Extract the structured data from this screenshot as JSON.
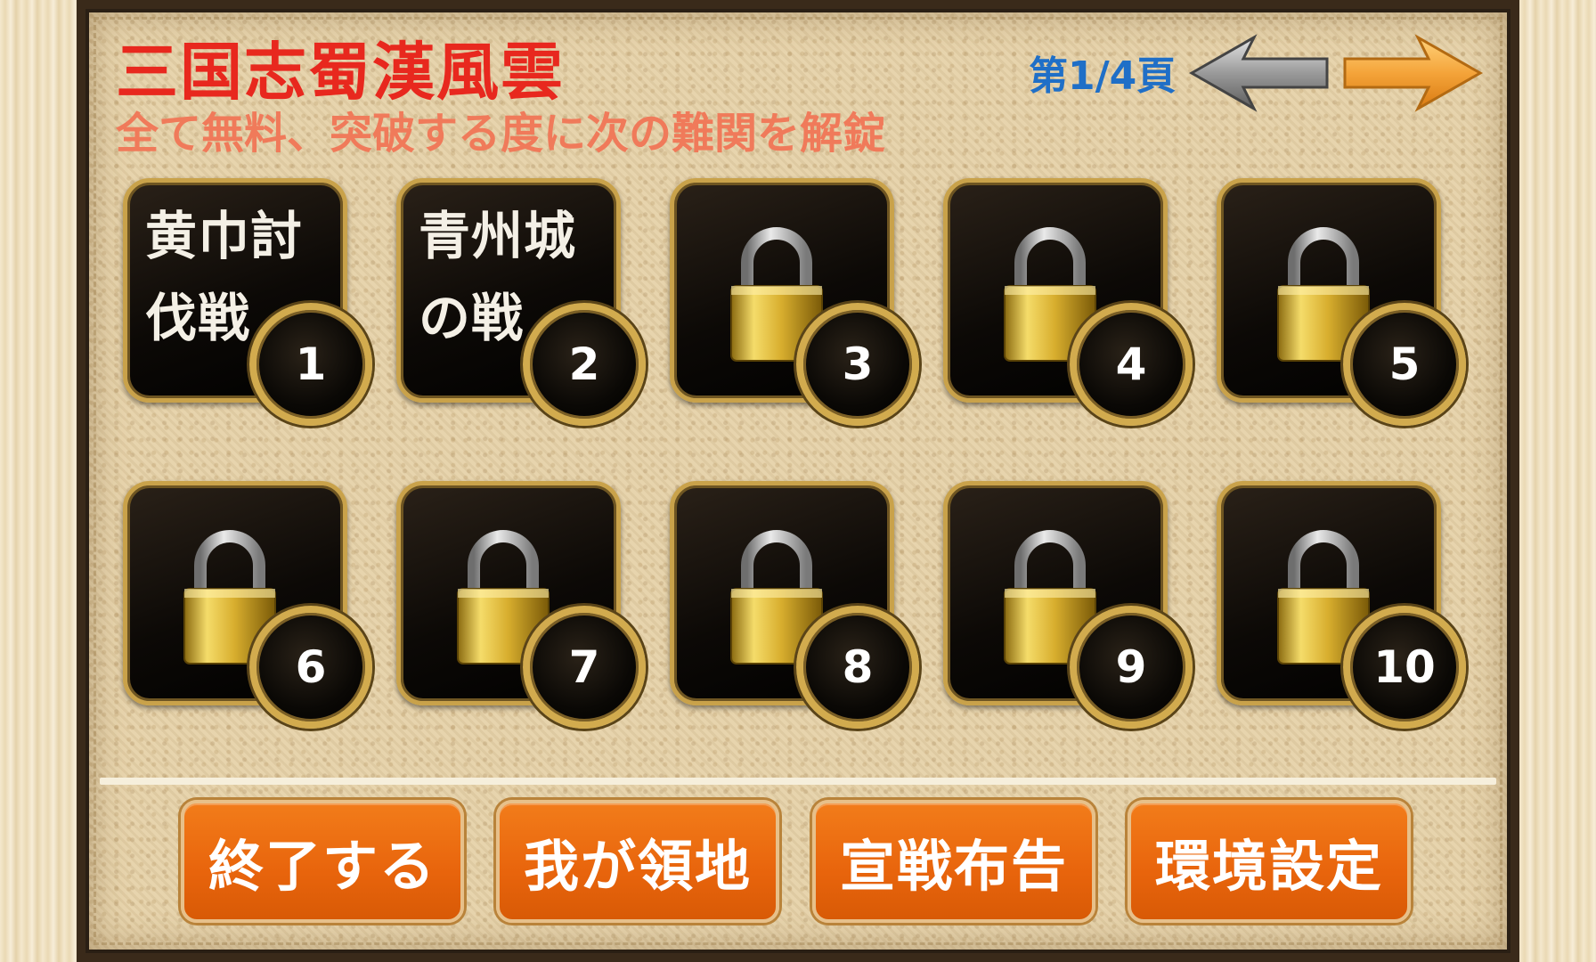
{
  "header": {
    "title": "三国志蜀漢風雲",
    "subtitle": "全て無料、突破する度に次の難関を解錠",
    "page_indicator": "第1/4頁",
    "prev_icon": "arrow-left-icon",
    "next_icon": "arrow-right-icon"
  },
  "colors": {
    "title": "#e8281e",
    "subtitle": "#f07a5a",
    "page_indicator": "#1f6fc7",
    "button": "#e8640c",
    "tile_border": "#c9a24a"
  },
  "stages": [
    {
      "number": "1",
      "name": "黄巾討伐戦",
      "locked": false
    },
    {
      "number": "2",
      "name": "青州城の戦",
      "locked": false
    },
    {
      "number": "3",
      "name": "",
      "locked": true,
      "icon": "lock-icon"
    },
    {
      "number": "4",
      "name": "",
      "locked": true,
      "icon": "lock-icon"
    },
    {
      "number": "5",
      "name": "",
      "locked": true,
      "icon": "lock-icon"
    },
    {
      "number": "6",
      "name": "",
      "locked": true,
      "icon": "lock-icon"
    },
    {
      "number": "7",
      "name": "",
      "locked": true,
      "icon": "lock-icon"
    },
    {
      "number": "8",
      "name": "",
      "locked": true,
      "icon": "lock-icon"
    },
    {
      "number": "9",
      "name": "",
      "locked": true,
      "icon": "lock-icon"
    },
    {
      "number": "10",
      "name": "",
      "locked": true,
      "icon": "lock-icon"
    }
  ],
  "menu": {
    "quit": "終了する",
    "territory": "我が領地",
    "declare_war": "宣戦布告",
    "settings": "環境設定"
  }
}
